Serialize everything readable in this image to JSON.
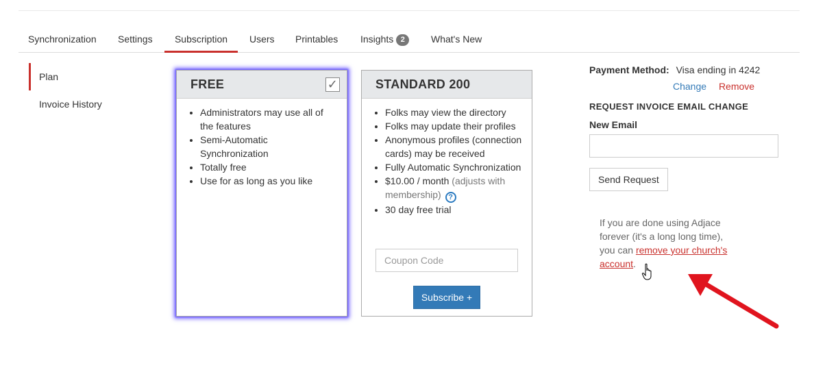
{
  "tabs": [
    {
      "label": "Synchronization"
    },
    {
      "label": "Settings"
    },
    {
      "label": "Subscription",
      "active": true
    },
    {
      "label": "Users"
    },
    {
      "label": "Printables"
    },
    {
      "label": "Insights",
      "badge": "2"
    },
    {
      "label": "What's New"
    }
  ],
  "sidebar": {
    "items": [
      {
        "label": "Plan",
        "active": true
      },
      {
        "label": "Invoice History"
      }
    ]
  },
  "plans": {
    "free": {
      "title": "FREE",
      "selected": true,
      "features": [
        "Administrators may use all of the features",
        "Semi-Automatic Synchronization",
        "Totally free",
        "Use for as long as you like"
      ]
    },
    "standard": {
      "title": "STANDARD 200",
      "features": [
        "Folks may view the directory",
        "Folks may update their profiles",
        "Anonymous profiles (connection cards) may be received",
        "Fully Automatic Synchronization"
      ],
      "price": "$10.00 / month",
      "price_note": "(adjusts with membership)",
      "trial": "30 day free trial",
      "coupon_placeholder": "Coupon Code",
      "subscribe_label": "Subscribe +"
    }
  },
  "payment": {
    "label": "Payment Method:",
    "value": "Visa ending in 4242",
    "change_label": "Change",
    "remove_label": "Remove"
  },
  "invoice_email": {
    "heading": "REQUEST INVOICE EMAIL CHANGE",
    "field_label": "New Email",
    "value": "",
    "send_label": "Send Request"
  },
  "remove_note": {
    "prefix": "If you are done using Adjace forever (it's a long long time), you can ",
    "link": "remove your church's account",
    "suffix": "."
  },
  "colors": {
    "accent": "#c9302c",
    "primary": "#337ab7",
    "selected_glow": "#7b6bff",
    "annotation_arrow": "#e0141e"
  }
}
